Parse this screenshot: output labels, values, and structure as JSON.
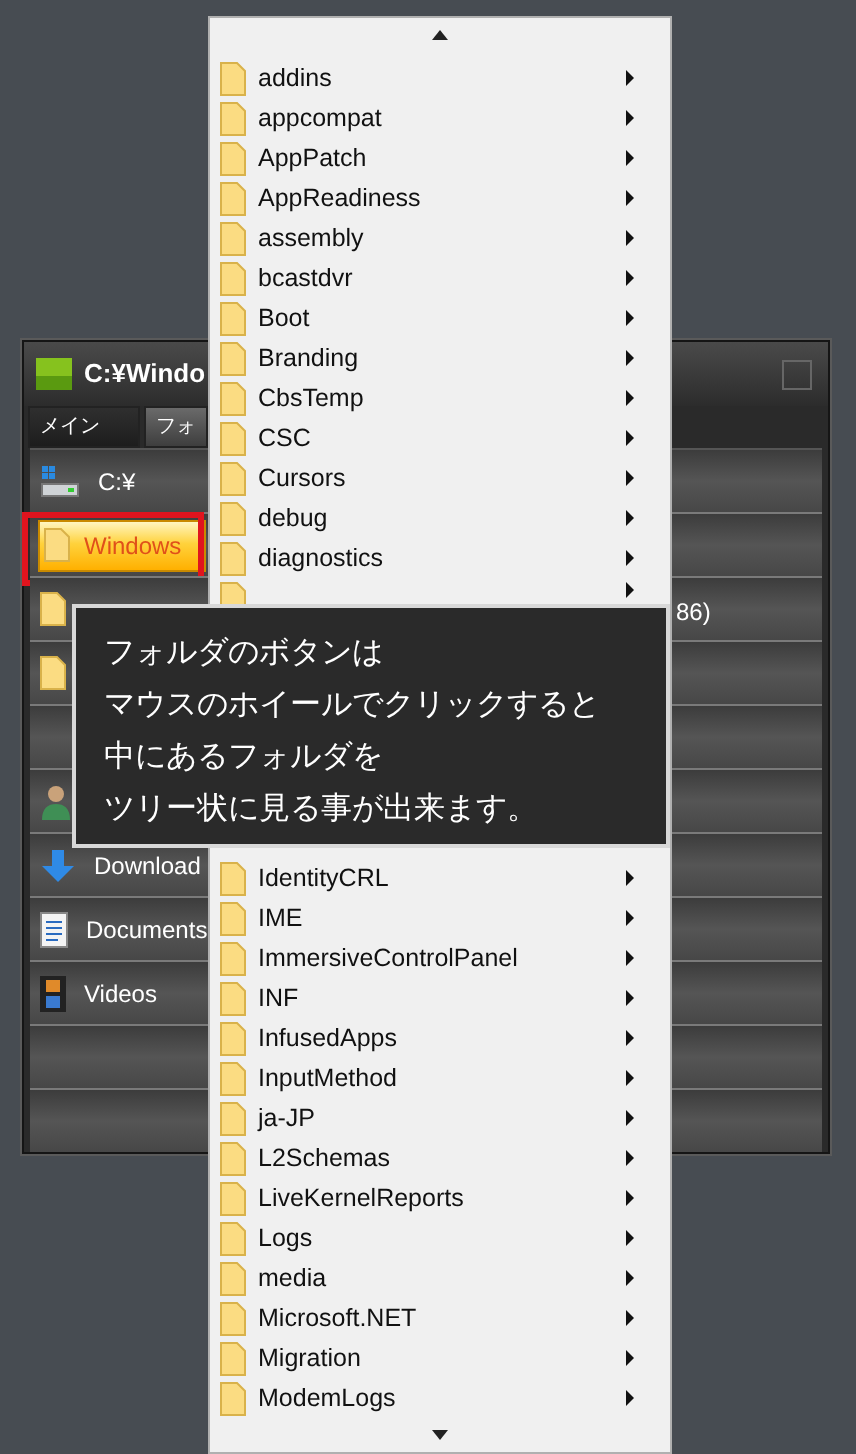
{
  "window": {
    "title": "C:¥Windo",
    "tabs": [
      {
        "label": "メイン",
        "selected": true
      },
      {
        "label": "フォ",
        "selected": false
      }
    ],
    "rows": [
      {
        "kind": "drive",
        "label": "C:¥",
        "selected": false,
        "outlined": false
      },
      {
        "kind": "folder",
        "label": "Windows",
        "selected": true,
        "outlined": true
      },
      {
        "kind": "folder-tail",
        "label": "86)",
        "selected": false,
        "outlined": false
      },
      {
        "kind": "folder",
        "selected": false,
        "outlined": false
      },
      {
        "kind": "empty",
        "selected": false,
        "outlined": false
      },
      {
        "kind": "user",
        "selected": false,
        "outlined": false
      },
      {
        "kind": "download",
        "label": "Download",
        "selected": false,
        "outlined": false
      },
      {
        "kind": "document",
        "label": "Documents",
        "selected": false,
        "outlined": false
      },
      {
        "kind": "video",
        "label": "Videos",
        "selected": false,
        "outlined": false
      },
      {
        "kind": "empty",
        "selected": false,
        "outlined": false
      },
      {
        "kind": "empty",
        "selected": false,
        "outlined": false
      }
    ]
  },
  "menu": {
    "items_above_tooltip": [
      "addins",
      "appcompat",
      "AppPatch",
      "AppReadiness",
      "assembly",
      "bcastdvr",
      "Boot",
      "Branding",
      "CbsTemp",
      "CSC",
      "Cursors",
      "debug",
      "diagnostics"
    ],
    "items_below_tooltip": [
      "IdentityCRL",
      "IME",
      "ImmersiveControlPanel",
      "INF",
      "InfusedApps",
      "InputMethod",
      "ja-JP",
      "L2Schemas",
      "LiveKernelReports",
      "Logs",
      "media",
      "Microsoft.NET",
      "Migration",
      "ModemLogs"
    ]
  },
  "tooltip": {
    "lines": [
      "フォルダのボタンは",
      "マウスのホイールでクリックすると",
      "中にあるフォルダを",
      "ツリー状に見る事が出来ます。"
    ]
  }
}
